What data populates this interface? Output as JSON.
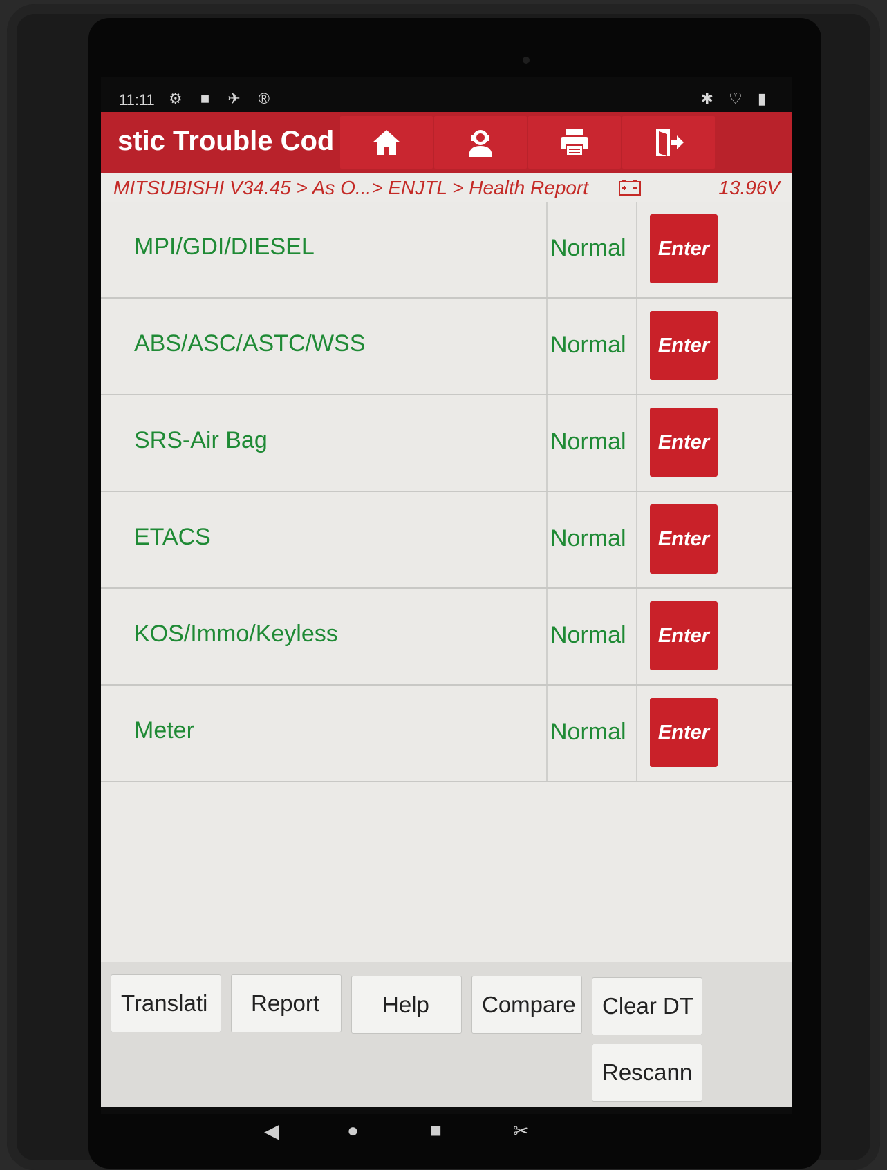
{
  "status_bar": {
    "time": "11:11",
    "left_icons": "⚙ ■ ✈ ®",
    "right_icons": "✱ ♡ ▮"
  },
  "app_bar": {
    "title": "stic Trouble Cod",
    "buttons": [
      {
        "icon": "home-icon"
      },
      {
        "icon": "support-agent-icon"
      },
      {
        "icon": "print-icon"
      },
      {
        "icon": "exit-icon"
      }
    ],
    "accent_color": "#b9222b"
  },
  "breadcrumb": {
    "path": "MITSUBISHI V34.45 > As O...> ENJTL > Health Report",
    "battery_icon": "battery-icon",
    "voltage": "13.96V"
  },
  "systems": [
    {
      "name": "MPI/GDI/DIESEL",
      "status": "Normal",
      "action": "Enter"
    },
    {
      "name": "ABS/ASC/ASTC/WSS",
      "status": "Normal",
      "action": "Enter"
    },
    {
      "name": "SRS-Air Bag",
      "status": "Normal",
      "action": "Enter"
    },
    {
      "name": "ETACS",
      "status": "Normal",
      "action": "Enter"
    },
    {
      "name": "KOS/Immo/Keyless",
      "status": "Normal",
      "action": "Enter"
    },
    {
      "name": "Meter",
      "status": "Normal",
      "action": "Enter"
    }
  ],
  "toolbar": {
    "translation": "Translati",
    "report": "Report",
    "help": "Help",
    "compare": "Compare",
    "clear_dtc": "Clear DT",
    "rescan": "Rescann"
  },
  "nav": {
    "back": "◀",
    "home": "●",
    "recents": "■",
    "screenshot": "✂"
  },
  "colors": {
    "status_green": "#1f8a35",
    "enter_red": "#c92129"
  }
}
